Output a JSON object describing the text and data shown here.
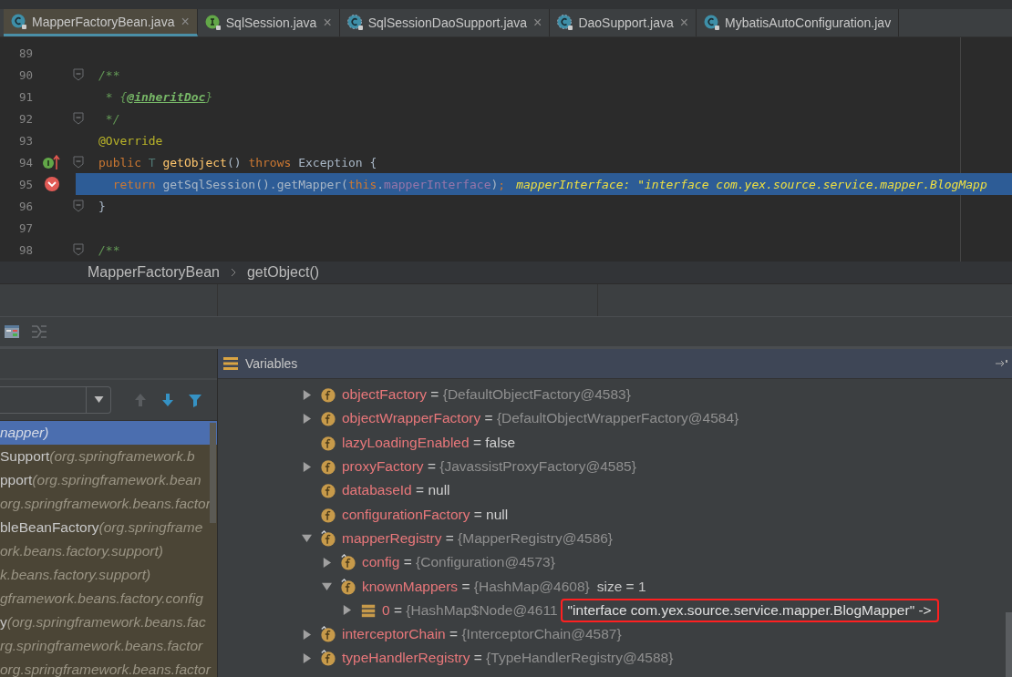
{
  "tabs": [
    {
      "label": "MapperFactoryBean.java",
      "kind": "class",
      "close": "×",
      "selected": true
    },
    {
      "label": "SqlSession.java",
      "kind": "interface",
      "close": "×",
      "selected": false
    },
    {
      "label": "SqlSessionDaoSupport.java",
      "kind": "abstract",
      "close": "×",
      "selected": false
    },
    {
      "label": "DaoSupport.java",
      "kind": "abstract",
      "close": "×",
      "selected": false
    },
    {
      "label": "MybatisAutoConfiguration.jav",
      "kind": "class",
      "selected": false
    }
  ],
  "editor": {
    "lines": [
      {
        "number": "89",
        "fold": false,
        "current": false,
        "kind": "plain"
      },
      {
        "number": "90",
        "fold": true,
        "current": false,
        "tokens": [
          {
            "t": "/**",
            "kind": "comment"
          }
        ]
      },
      {
        "number": "91",
        "fold": false,
        "current": false,
        "tokens": [
          {
            "t": " * {",
            "kind": "comment"
          },
          {
            "t": "@inheritDoc",
            "kind": "doctag"
          },
          {
            "t": "}",
            "kind": "comment"
          }
        ]
      },
      {
        "number": "92",
        "fold": true,
        "current": false,
        "tokens": [
          {
            "t": " */",
            "kind": "comment"
          }
        ]
      },
      {
        "number": "93",
        "fold": false,
        "current": false,
        "tokens": [
          {
            "t": "@Override",
            "kind": "annotation"
          }
        ]
      },
      {
        "number": "94",
        "fold": true,
        "current": false,
        "kind": "implements",
        "tokens": [
          {
            "t": "public ",
            "kind": "keyword"
          },
          {
            "t": "T ",
            "kind": "typeparam"
          },
          {
            "t": "getObject",
            "kind": "method"
          },
          {
            "t": "() ",
            "kind": "plain"
          },
          {
            "t": "throws ",
            "kind": "keyword"
          },
          {
            "t": "Exception {",
            "kind": "plain"
          }
        ]
      },
      {
        "number": "95",
        "fold": false,
        "current": true,
        "kind": "breakpoint",
        "tokens": [
          {
            "t": "  return ",
            "kind": "keyword"
          },
          {
            "t": "getSqlSession().getMapper(",
            "kind": "plain"
          },
          {
            "t": "this",
            "kind": "keyword"
          },
          {
            "t": ".",
            "kind": "plain"
          },
          {
            "t": "mapperInterface",
            "kind": "field"
          },
          {
            "t": ")",
            "kind": "plain"
          },
          {
            "t": ";",
            "kind": "keyword"
          },
          {
            "t": "mapperInterface: \"interface com.yex.source.service.mapper.BlogMapp",
            "kind": "inline"
          }
        ]
      },
      {
        "number": "96",
        "fold": true,
        "current": false,
        "tokens": [
          {
            "t": "}",
            "kind": "plain"
          }
        ]
      },
      {
        "number": "97",
        "fold": false,
        "current": false,
        "kind": "plain"
      },
      {
        "number": "98",
        "fold": true,
        "current": false,
        "tokens": [
          {
            "t": "/**",
            "kind": "comment"
          }
        ]
      }
    ]
  },
  "breadcrumb": [
    "MapperFactoryBean",
    "getObject()"
  ],
  "frames": [
    {
      "package": "napper)",
      "selected": true
    },
    {
      "method": "Support",
      "package": "(org.springframework.b",
      "selected": false
    },
    {
      "method": "pport",
      "package": "(org.springframework.bean",
      "selected": false
    },
    {
      "package": "org.springframework.beans.factor",
      "selected": false
    },
    {
      "method": "bleBeanFactory",
      "package": "(org.springframe",
      "selected": false
    },
    {
      "package": "ork.beans.factory.support)",
      "selected": false
    },
    {
      "package": "k.beans.factory.support)",
      "selected": false
    },
    {
      "package": "gframework.beans.factory.config",
      "selected": false
    },
    {
      "method": "y",
      "package": "(org.springframework.beans.fac",
      "selected": false
    },
    {
      "package": "rg.springframework.beans.factor",
      "selected": false
    },
    {
      "package": "org.springframework.beans.factor",
      "selected": false
    }
  ],
  "variables": {
    "title": "Variables",
    "nodes": [
      {
        "name": "objectFactory",
        "separator": "=",
        "value": "{DefaultObjectFactory@4583}",
        "kind": "field",
        "final": false,
        "primitive": false,
        "expanded": false
      },
      {
        "name": "objectWrapperFactory",
        "separator": "=",
        "value": "{DefaultObjectWrapperFactory@4584}",
        "kind": "field",
        "final": false,
        "primitive": false,
        "expanded": false
      },
      {
        "name": "lazyLoadingEnabled",
        "separator": "=",
        "value": "false",
        "kind": "field",
        "final": false,
        "primitive": true
      },
      {
        "name": "proxyFactory",
        "separator": "=",
        "value": "{JavassistProxyFactory@4585}",
        "kind": "field",
        "final": false,
        "primitive": false,
        "expanded": false
      },
      {
        "name": "databaseId",
        "separator": "=",
        "value": "null",
        "kind": "field",
        "final": false,
        "primitive": true
      },
      {
        "name": "configurationFactory",
        "separator": "=",
        "value": "null",
        "kind": "field",
        "final": false,
        "primitive": true
      },
      {
        "name": "mapperRegistry",
        "separator": "=",
        "value": "{MapperRegistry@4586}",
        "kind": "field",
        "final": true,
        "primitive": false,
        "expanded": true,
        "children": [
          {
            "name": "config",
            "separator": "=",
            "value": "{Configuration@4573}",
            "kind": "field",
            "final": true,
            "primitive": false,
            "expanded": false
          },
          {
            "name": "knownMappers",
            "separator": "=",
            "value": "{HashMap@4608}",
            "extra": "size = 1",
            "kind": "field",
            "final": true,
            "primitive": false,
            "expanded": true,
            "children": [
              {
                "name": "0",
                "separator": "=",
                "value": "{HashMap$Node@4611",
                "highlight": "\"interface com.yex.source.service.mapper.BlogMapper\" ->",
                "kind": "entry",
                "primitive": false,
                "expanded": false
              }
            ]
          }
        ]
      },
      {
        "name": "interceptorChain",
        "separator": "=",
        "value": "{InterceptorChain@4587}",
        "kind": "field",
        "final": true,
        "primitive": false,
        "expanded": false
      },
      {
        "name": "typeHandlerRegistry",
        "separator": "=",
        "value": "{TypeHandlerRegistry@4588}",
        "kind": "field",
        "final": true,
        "primitive": false,
        "expanded": false
      }
    ]
  }
}
